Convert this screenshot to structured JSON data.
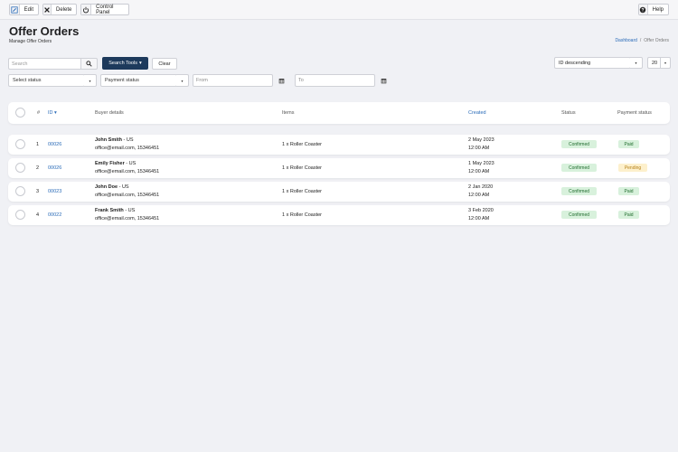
{
  "toolbar": {
    "edit_label": "Edit",
    "delete_label": "Delete",
    "control_panel_label": "Control Panel",
    "help_label": "Help"
  },
  "header": {
    "title": "Offer Orders",
    "subtitle": "Manage Offer Orders",
    "breadcrumb": {
      "dashboard": "Dashboard",
      "separator": "/",
      "current": "Offer Orders"
    }
  },
  "search": {
    "placeholder": "Search",
    "tools_label": "Search Tools",
    "tools_caret": "▾",
    "clear_label": "Clear"
  },
  "sort": {
    "selected": "ID descending",
    "per_page": "20",
    "caret": "▾"
  },
  "filters": {
    "status_placeholder": "Select status",
    "payment_placeholder": "Payment status",
    "from_placeholder": "From",
    "to_placeholder": "To",
    "caret": "▾"
  },
  "table": {
    "columns": {
      "index": "#",
      "id": "ID",
      "id_sort": "▾",
      "buyer": "Buyer details",
      "items": "Items",
      "created": "Created",
      "status": "Status",
      "payment": "Payment status"
    },
    "rows": [
      {
        "index": "1",
        "id": "00026",
        "name": "John Smith",
        "country": " - US",
        "contact": "office@email.com, 15346451",
        "items": "1 x Roller Coaster",
        "date": "2 May 2023",
        "time": "12:00 AM",
        "status": "Confirmed",
        "payment": "Paid"
      },
      {
        "index": "2",
        "id": "00026",
        "name": "Emily Fisher",
        "country": " - US",
        "contact": "office@email.com, 15346451",
        "items": "1 x Roller Coaster",
        "date": "1 May 2023",
        "time": "12:00 AM",
        "status": "Confirmed",
        "payment": "Pending"
      },
      {
        "index": "3",
        "id": "00023",
        "name": "John Doe",
        "country": " - US",
        "contact": "office@email.com, 15346451",
        "items": "1 x Roller Coaster",
        "date": "2 Jan 2020",
        "time": "12:00 AM",
        "status": "Confirmed",
        "payment": "Paid"
      },
      {
        "index": "4",
        "id": "00022",
        "name": "Frank Smith",
        "country": " - US",
        "contact": "office@email.com, 15346451",
        "items": "1 x Roller Coaster",
        "date": "3 Feb 2020",
        "time": "12:00 AM",
        "status": "Confirmed",
        "payment": "Paid"
      }
    ]
  },
  "colors": {
    "accent": "#1d3a5c",
    "link": "#2a6bb8",
    "confirmed_bg": "#d8f1dc",
    "pending_bg": "#fdf0cc"
  },
  "icons": {
    "edit": "edit-icon",
    "delete": "close-icon",
    "control_panel": "power-icon",
    "help": "help-icon",
    "search": "search-icon",
    "calendar": "calendar-icon"
  }
}
